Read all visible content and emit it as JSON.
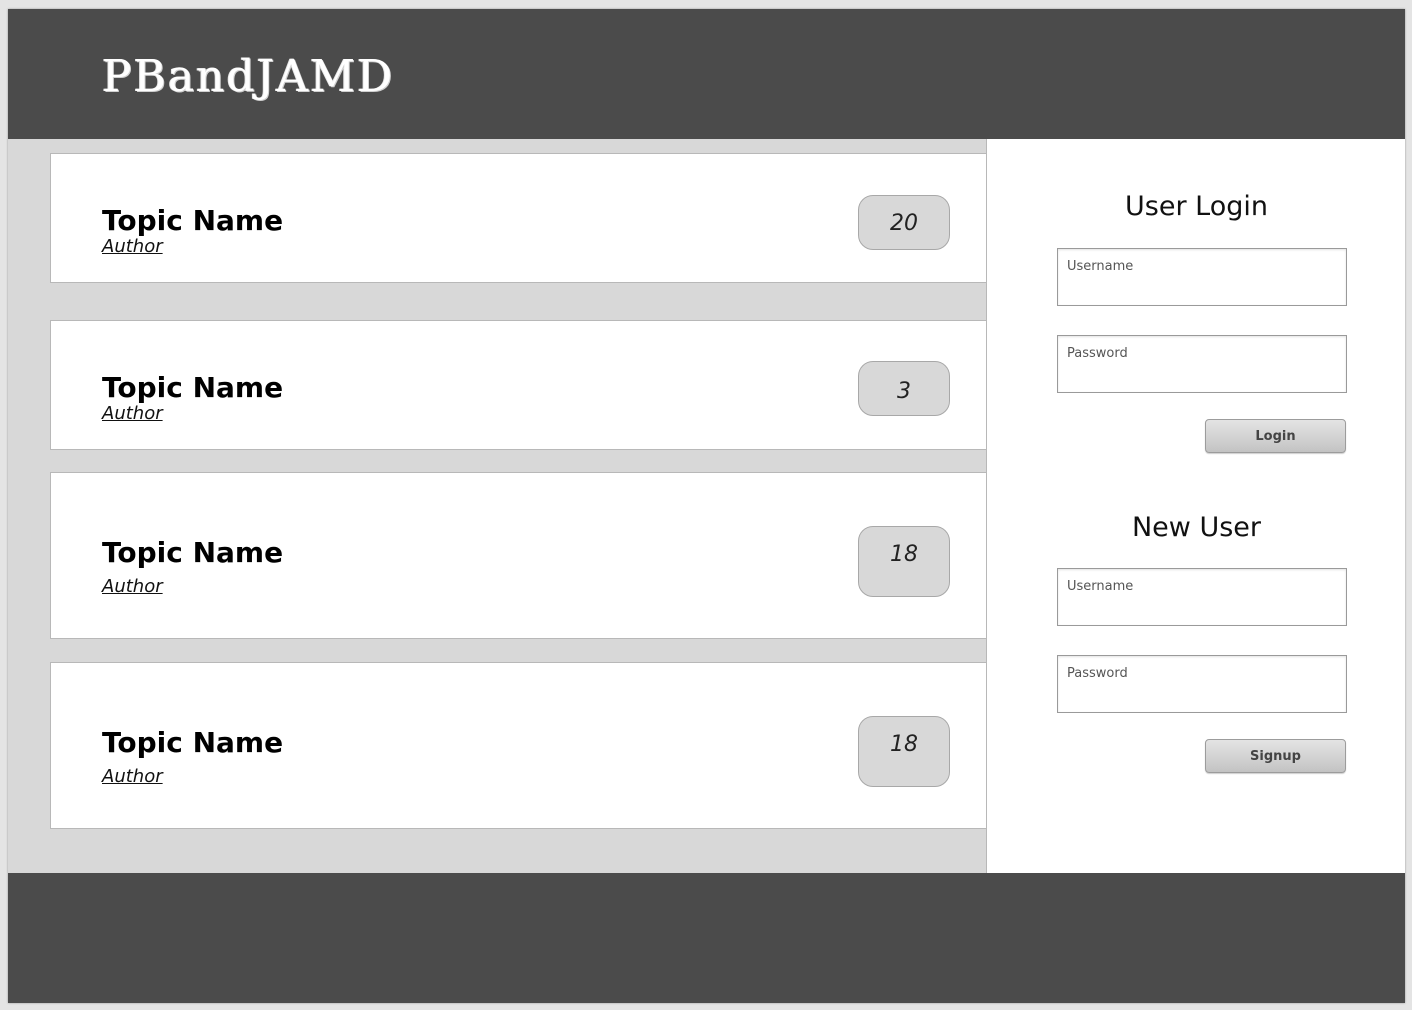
{
  "app": {
    "logo_text": "PBandJAMD"
  },
  "topics": [
    {
      "title": "Topic Name",
      "author": "Author",
      "count": "20"
    },
    {
      "title": "Topic Name",
      "author": "Author",
      "count": "3"
    },
    {
      "title": "Topic Name",
      "author": "Author",
      "count": "18"
    },
    {
      "title": "Topic Name",
      "author": "Author",
      "count": "18"
    }
  ],
  "login": {
    "heading": "User Login",
    "username_placeholder": "Username",
    "password_placeholder": "Password",
    "button_label": "Login"
  },
  "signup": {
    "heading": "New User",
    "username_placeholder": "Username",
    "password_placeholder": "Password",
    "button_label": "Signup"
  },
  "colors": {
    "header_bg": "#4b4b4b",
    "page_bg": "#d8d8d8",
    "card_bg": "#ffffff",
    "badge_bg": "#d8d8d8"
  }
}
